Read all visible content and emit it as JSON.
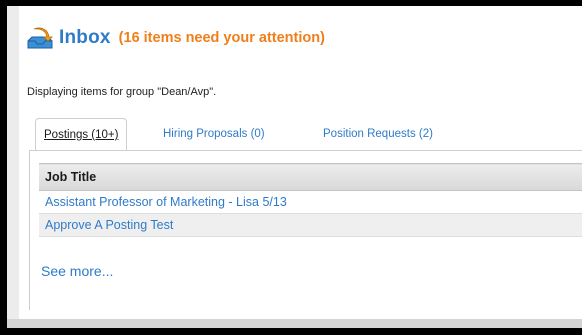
{
  "header": {
    "title": "Inbox",
    "attention": "(16 items need your attention)",
    "icon": "inbox-tray-icon",
    "colors": {
      "title": "#2f7bc9",
      "attention": "#f07f1a"
    }
  },
  "group_line": "Displaying items for group \"Dean/Avp\".",
  "tabs": [
    {
      "label": "Postings (10+)",
      "active": true
    },
    {
      "label": "Hiring Proposals (0)",
      "active": false
    },
    {
      "label": "Position Requests (2)",
      "active": false
    }
  ],
  "table": {
    "headers": [
      "Job Title"
    ],
    "rows": [
      [
        "Assistant Professor of Marketing - Lisa 5/13"
      ],
      [
        "Approve A Posting Test"
      ]
    ]
  },
  "see_more": "See more..."
}
